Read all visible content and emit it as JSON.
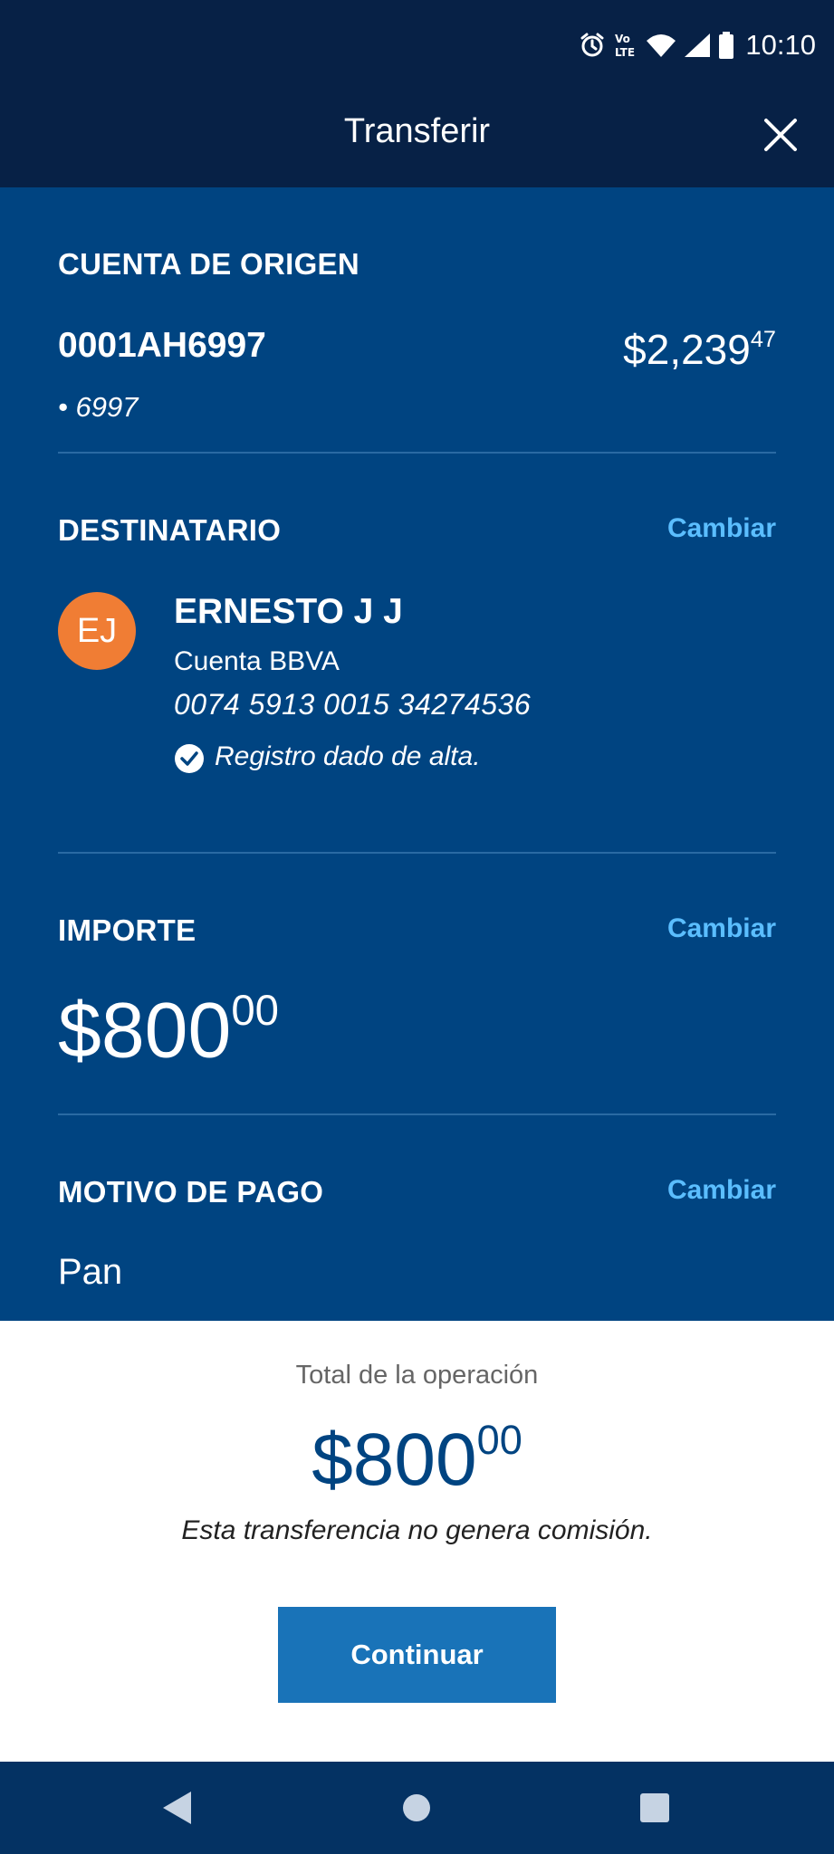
{
  "status_bar": {
    "time": "10:10",
    "icons": [
      "alarm-icon",
      "volte-icon",
      "wifi-icon",
      "cell-signal-icon",
      "battery-icon"
    ]
  },
  "app_bar": {
    "title": "Transferir",
    "close_icon": "close-icon"
  },
  "origin": {
    "title": "CUENTA DE ORIGEN",
    "account_name": "0001AH6997",
    "balance_main": "$2,239",
    "balance_cents": "47",
    "account_mask": "• 6997"
  },
  "recipient": {
    "title": "DESTINATARIO",
    "change_label": "Cambiar",
    "initials": "EJ",
    "name": "ERNESTO J J",
    "bank": "Cuenta BBVA",
    "account_number": "0074 5913 0015 34274536",
    "status": "Registro dado de alta."
  },
  "amount": {
    "title": "IMPORTE",
    "change_label": "Cambiar",
    "main": "$800",
    "cents": "00"
  },
  "reason": {
    "title": "MOTIVO DE PAGO",
    "change_label": "Cambiar",
    "value": "Pan"
  },
  "footer": {
    "total_label": "Total de la operación",
    "total_main": "$800",
    "total_cents": "00",
    "fee_note": "Esta transferencia no genera comisión.",
    "continue_label": "Continuar"
  },
  "nav": {
    "back_icon": "back-icon",
    "home_icon": "home-icon",
    "recents_icon": "recents-icon"
  },
  "colors": {
    "header": "#072146",
    "content": "#004481",
    "link": "#5bbeff",
    "avatar": "#f07d34",
    "button": "#1973b8",
    "nav": "#043263"
  }
}
